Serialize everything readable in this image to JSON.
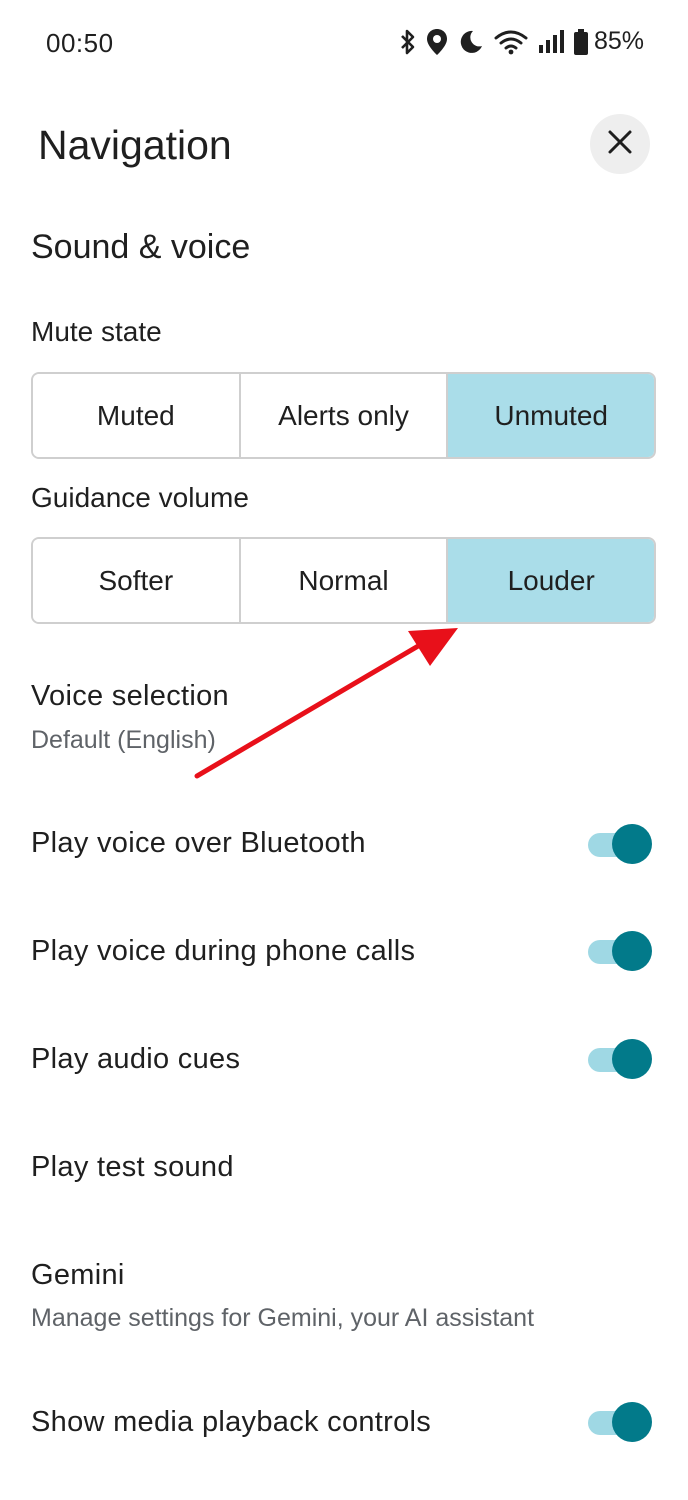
{
  "status_bar": {
    "time": "00:50",
    "battery_percent": "85%",
    "icons": [
      "bluetooth-icon",
      "location-icon",
      "do-not-disturb-moon-icon",
      "wifi-icon",
      "cell-signal-icon",
      "battery-icon"
    ]
  },
  "header": {
    "title": "Navigation",
    "close_icon": "close-icon"
  },
  "section": {
    "title": "Sound & voice"
  },
  "mute_state": {
    "label": "Mute state",
    "options": [
      "Muted",
      "Alerts only",
      "Unmuted"
    ],
    "selected": "Unmuted"
  },
  "guidance_volume": {
    "label": "Guidance volume",
    "options": [
      "Softer",
      "Normal",
      "Louder"
    ],
    "selected": "Louder"
  },
  "voice_selection": {
    "title": "Voice selection",
    "subtitle": "Default (English)"
  },
  "settings": [
    {
      "label": "Play voice over Bluetooth",
      "toggle": true
    },
    {
      "label": "Play voice during phone calls",
      "toggle": true
    },
    {
      "label": "Play audio cues",
      "toggle": true
    },
    {
      "label": "Play test sound"
    },
    {
      "label": "Gemini",
      "subtitle": "Manage settings for Gemini, your AI assistant"
    },
    {
      "label": "Show media playback controls",
      "toggle": true
    }
  ],
  "colors": {
    "selected_segment": "#aadde9",
    "toggle_thumb": "#027a8a",
    "toggle_track": "#9fd8e4",
    "annotation_arrow": "#e8101a"
  }
}
